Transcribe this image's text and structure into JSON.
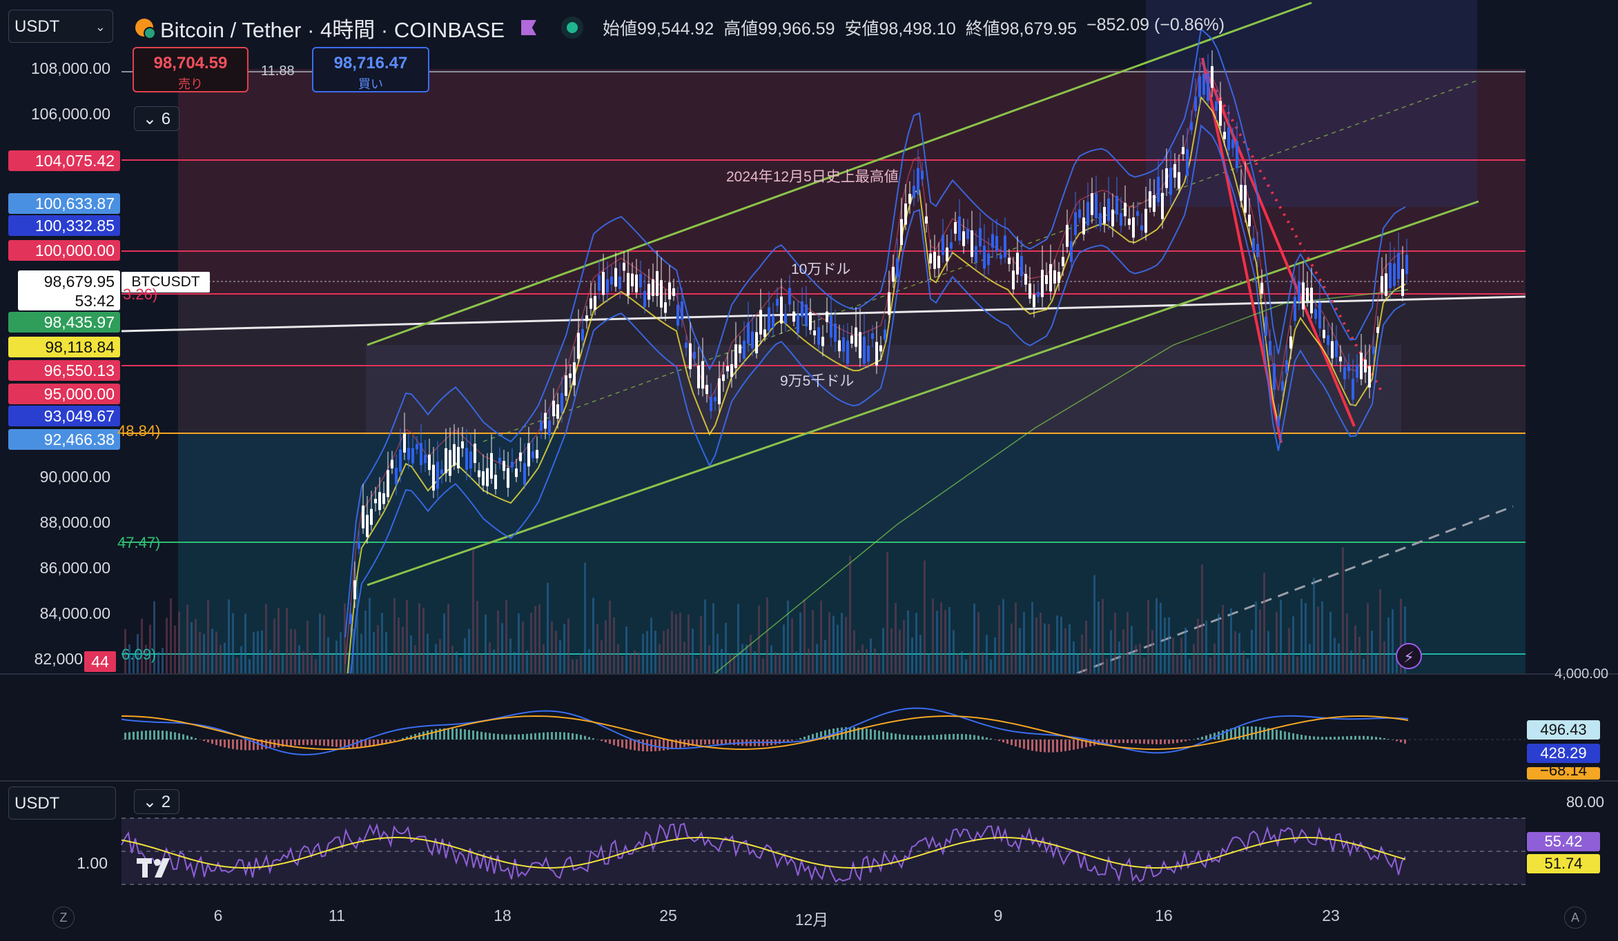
{
  "header": {
    "currency_select": "USDT",
    "title": "Bitcoin / Tether · 4時間 · COINBASE",
    "ohlc": {
      "open_label": "始値",
      "open": "99,544.92",
      "high_label": "高値",
      "high": "99,966.59",
      "low_label": "安値",
      "low": "98,498.10",
      "close_label": "終値",
      "close": "98,679.95",
      "change": "−852.09 (−0.86%)"
    }
  },
  "trade": {
    "sell_price": "98,704.59",
    "sell_label": "売り",
    "spread": "11.88",
    "buy_price": "98,716.47",
    "buy_label": "買い"
  },
  "indicator_collapse": {
    "main": "6",
    "lower": "2"
  },
  "lower_select": "USDT",
  "price_axis": [
    "108,000.00",
    "106,000.00",
    "90,000.00",
    "88,000.00",
    "86,000.00",
    "84,000.00",
    "82,000"
  ],
  "price_tags": [
    {
      "value": "104,075.42",
      "color": "#e2335a"
    },
    {
      "value": "100,633.87",
      "color": "#4a90e2"
    },
    {
      "value": "100,332.85",
      "color": "#2a3fd0"
    },
    {
      "value": "100,000.00",
      "color": "#e2335a"
    },
    {
      "value": "98,435.97",
      "color": "#2f9e5a"
    },
    {
      "value": "98,118.84",
      "color": "#f2e33a"
    },
    {
      "value": "96,550.13",
      "color": "#e2335a"
    },
    {
      "value": "95,000.00",
      "color": "#e2335a"
    },
    {
      "value": "93,049.67",
      "color": "#2a3fd0"
    },
    {
      "value": "92,466.38",
      "color": "#4a90e2"
    }
  ],
  "current_price": {
    "price": "98,679.95",
    "countdown": "53:42",
    "symbol": "BTCUSDT"
  },
  "partial_labels": [
    "3.26)",
    "48.84)",
    "47.47)",
    "6.09)"
  ],
  "volume_badge": "44",
  "macd_axis": {
    "top": "4,000.00",
    "values": [
      {
        "value": "496.43",
        "color": "#bfe6f2"
      },
      {
        "value": "428.29",
        "color": "#2a3fd0"
      },
      {
        "value": "−68.14",
        "color": "#f5a623"
      }
    ]
  },
  "rsi_axis": {
    "top": "80.00",
    "left_value": "1.00",
    "values": [
      {
        "value": "55.42",
        "color": "#8e5fd6"
      },
      {
        "value": "51.74",
        "color": "#f2e33a"
      }
    ]
  },
  "annotations": {
    "ath": "2024年12月5日史上最高値",
    "level_100k": "10万ドル",
    "level_95k": "9万5千ドル"
  },
  "x_axis": [
    "6",
    "11",
    "18",
    "25",
    "12月",
    "9",
    "16",
    "23"
  ],
  "corner_left": "Z",
  "corner_right": "A",
  "colors": {
    "bull": "#2f62f0",
    "bear": "#ffffff",
    "resistance": "#e2335a",
    "support": "#2fbf71"
  }
}
